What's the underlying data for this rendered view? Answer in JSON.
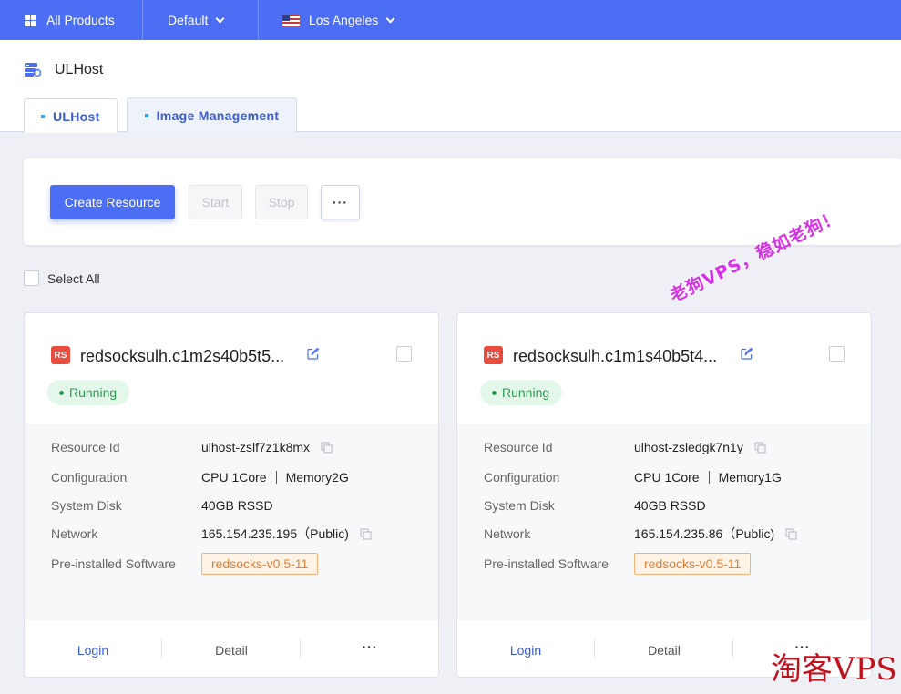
{
  "topbar": {
    "products_label": "All Products",
    "project_label": "Default",
    "region_label": "Los Angeles",
    "brand_color": "#4b6ef5"
  },
  "header": {
    "title": "ULHost",
    "tabs": [
      {
        "label": "ULHost",
        "active": true
      },
      {
        "label": "Image Management",
        "active": false
      }
    ]
  },
  "toolbar": {
    "create_label": "Create Resource",
    "start_label": "Start",
    "stop_label": "Stop",
    "more_label": "···"
  },
  "list": {
    "select_all_label": "Select All"
  },
  "cards": [
    {
      "badge": "RS",
      "name": "redsocksulh.c1m2s40b5t5...",
      "status": "Running",
      "fields": {
        "resource_id_label": "Resource Id",
        "resource_id": "ulhost-zslf7z1k8mx",
        "configuration_label": "Configuration",
        "cpu": "CPU 1Core",
        "memory": "Memory2G",
        "disk_label": "System Disk",
        "disk": "40GB RSSD",
        "network_label": "Network",
        "network": "165.154.235.195（Public)",
        "software_label": "Pre-installed Software",
        "software": "redsocks-v0.5-11"
      },
      "actions": {
        "login": "Login",
        "detail": "Detail",
        "more": "···"
      }
    },
    {
      "badge": "RS",
      "name": "redsocksulh.c1m1s40b5t4...",
      "status": "Running",
      "fields": {
        "resource_id_label": "Resource Id",
        "resource_id": "ulhost-zsledgk7n1y",
        "configuration_label": "Configuration",
        "cpu": "CPU 1Core",
        "memory": "Memory1G",
        "disk_label": "System Disk",
        "disk": "40GB RSSD",
        "network_label": "Network",
        "network": "165.154.235.86（Public)",
        "software_label": "Pre-installed Software",
        "software": "redsocks-v0.5-11"
      },
      "actions": {
        "login": "Login",
        "detail": "Detail",
        "more": "···"
      }
    }
  ],
  "watermarks": {
    "diagonal": "老狗VPS，稳如老狗！",
    "corner": "淘客VPS"
  },
  "colors": {
    "running": "#2b9b4e",
    "tag_orange": "#e0803b",
    "badge_red": "#e74c3c"
  }
}
